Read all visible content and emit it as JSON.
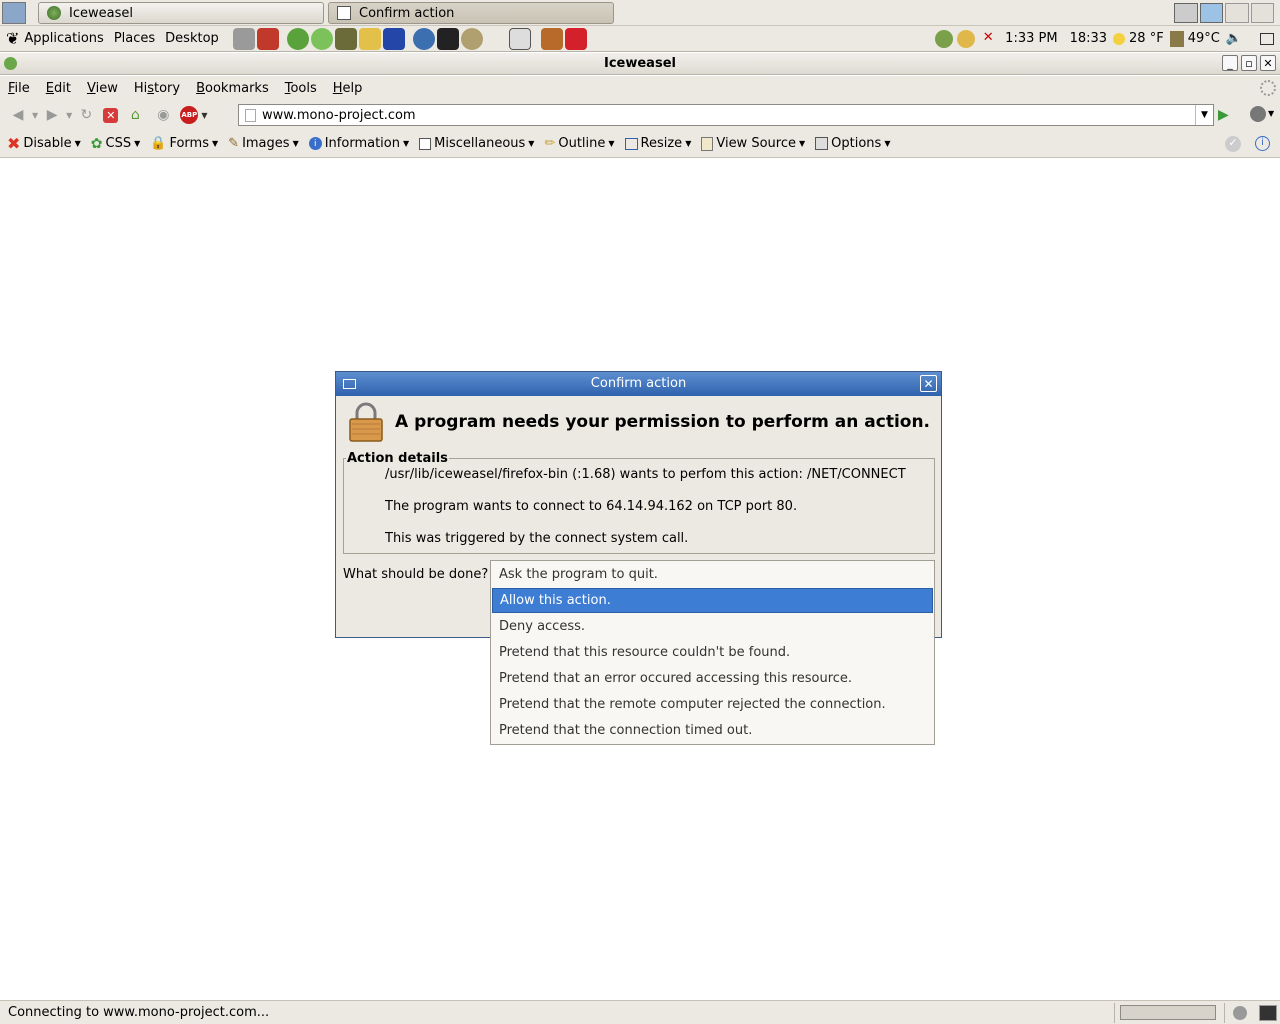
{
  "taskbar": {
    "windows": [
      {
        "label": "Iceweasel",
        "active": false
      },
      {
        "label": "Confirm action",
        "active": true
      }
    ]
  },
  "panel": {
    "menus": [
      "Applications",
      "Places",
      "Desktop"
    ],
    "clock_ampm": "1:33 PM",
    "clock_24": "18:33",
    "weather": "28 °F",
    "cpu_temp": "49°C"
  },
  "window": {
    "title": "Iceweasel"
  },
  "menubar": {
    "items": [
      {
        "u": "F",
        "rest": "ile"
      },
      {
        "u": "E",
        "rest": "dit"
      },
      {
        "u": "V",
        "rest": "iew"
      },
      {
        "pre": "Hi",
        "u": "s",
        "rest": "tory"
      },
      {
        "u": "B",
        "rest": "ookmarks"
      },
      {
        "u": "T",
        "rest": "ools"
      },
      {
        "u": "H",
        "rest": "elp"
      }
    ]
  },
  "navbar": {
    "url": "www.mono-project.com",
    "adblock_label": "ABP"
  },
  "devbar": {
    "items": [
      "Disable",
      "CSS",
      "Forms",
      "Images",
      "Information",
      "Miscellaneous",
      "Outline",
      "Resize",
      "View Source",
      "Options"
    ]
  },
  "status": {
    "text": "Connecting to www.mono-project.com..."
  },
  "dialog": {
    "title": "Confirm action",
    "heading": "A program needs your permission to perform an action.",
    "details_label": "Action details",
    "detail_lines": [
      "/usr/lib/iceweasel/firefox-bin (:1.68) wants to perfom this action: /NET/CONNECT",
      "The program wants to connect to 64.14.94.162 on TCP port 80.",
      "This was triggered by the connect system call."
    ],
    "question": "What should be done?",
    "options": [
      "Ask the program to quit.",
      "Allow this action.",
      "Deny access.",
      "Pretend that this resource couldn't be found.",
      "Pretend that an error occured accessing this resource.",
      "Pretend that the remote computer rejected the connection.",
      "Pretend that the connection timed out."
    ],
    "selected_index": 1
  },
  "colors": {
    "selection": "#3d7ed4",
    "dialog_title": "#2f62ad",
    "chrome_bg": "#ece9e2"
  }
}
